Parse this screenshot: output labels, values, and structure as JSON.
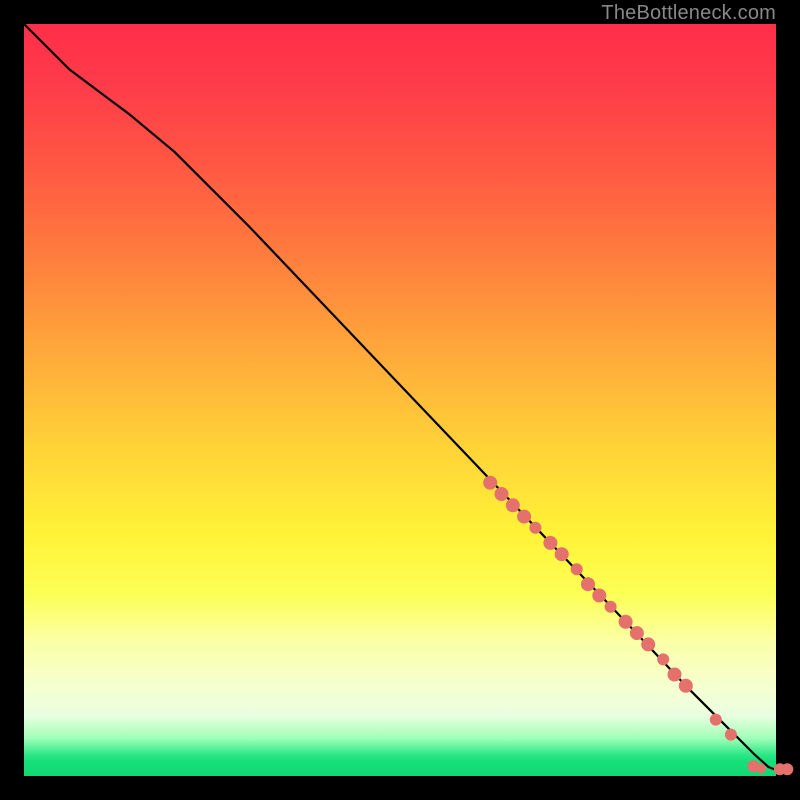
{
  "attribution": "TheBottleneck.com",
  "colors": {
    "dot": "#e4716b",
    "curve": "#000000"
  },
  "chart_data": {
    "type": "line",
    "title": "",
    "xlabel": "",
    "ylabel": "",
    "xlim": [
      0,
      100
    ],
    "ylim": [
      0,
      100
    ],
    "grid": false,
    "legend": false,
    "series": [
      {
        "name": "curve",
        "kind": "line",
        "x": [
          0,
          3,
          6,
          10,
          14,
          20,
          30,
          40,
          50,
          60,
          70,
          80,
          88,
          92,
          95,
          97,
          99,
          100
        ],
        "y": [
          100,
          97,
          94,
          91,
          88,
          83,
          73,
          62.5,
          52,
          41.5,
          31,
          20.5,
          12,
          8,
          5,
          3,
          1.2,
          0.8
        ]
      },
      {
        "name": "scatter",
        "kind": "scatter",
        "points": [
          {
            "x": 62,
            "y": 39,
            "r": 7
          },
          {
            "x": 63.5,
            "y": 37.5,
            "r": 7
          },
          {
            "x": 65,
            "y": 36,
            "r": 7
          },
          {
            "x": 66.5,
            "y": 34.5,
            "r": 7
          },
          {
            "x": 68,
            "y": 33,
            "r": 6
          },
          {
            "x": 70,
            "y": 31,
            "r": 7
          },
          {
            "x": 71.5,
            "y": 29.5,
            "r": 7
          },
          {
            "x": 73.5,
            "y": 27.5,
            "r": 6
          },
          {
            "x": 75,
            "y": 25.5,
            "r": 7
          },
          {
            "x": 76.5,
            "y": 24,
            "r": 7
          },
          {
            "x": 78,
            "y": 22.5,
            "r": 6
          },
          {
            "x": 80,
            "y": 20.5,
            "r": 7
          },
          {
            "x": 81.5,
            "y": 19,
            "r": 7
          },
          {
            "x": 83,
            "y": 17.5,
            "r": 7
          },
          {
            "x": 85,
            "y": 15.5,
            "r": 6
          },
          {
            "x": 86.5,
            "y": 13.5,
            "r": 7
          },
          {
            "x": 88,
            "y": 12,
            "r": 7
          },
          {
            "x": 92,
            "y": 7.5,
            "r": 6
          },
          {
            "x": 94,
            "y": 5.5,
            "r": 6
          },
          {
            "x": 97,
            "y": 1.3,
            "r": 6
          },
          {
            "x": 98,
            "y": 1.0,
            "r": 5
          },
          {
            "x": 100.5,
            "y": 0.9,
            "r": 6
          },
          {
            "x": 101.5,
            "y": 0.9,
            "r": 6
          }
        ]
      }
    ]
  }
}
